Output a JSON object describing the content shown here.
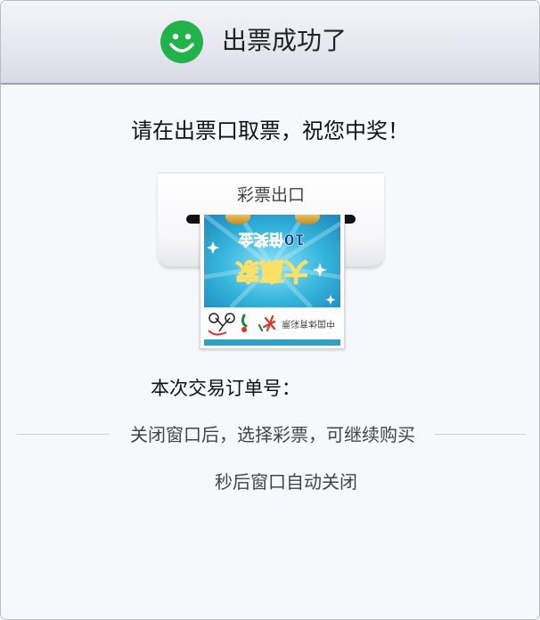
{
  "header": {
    "title": "出票成功了",
    "icon": "smiley-face-icon",
    "icon_color": "#21b24b"
  },
  "message": "请在出票口取票，祝您中奖！",
  "printer": {
    "slot_label": "彩票出口"
  },
  "ticket": {
    "headline_top": "10倍奖金",
    "headline_main": "大赢家",
    "brand_text": "中国体育彩票",
    "accent_color": "#27a4cc",
    "icons": [
      "sports-lottery-logo-icon",
      "sprinter-figure-icon",
      "bicycle-rider-icon"
    ]
  },
  "order": {
    "label": "本次交易订单号："
  },
  "tip": "关闭窗口后，选择彩票，可继续购买",
  "countdown": {
    "label": "秒后窗口自动关闭"
  }
}
